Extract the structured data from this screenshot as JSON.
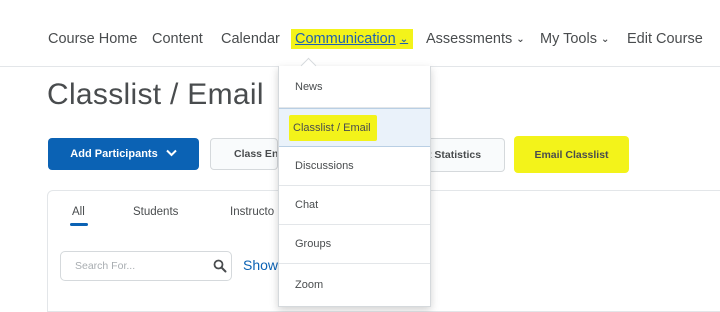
{
  "navbar": {
    "items": [
      {
        "label": "Course Home"
      },
      {
        "label": "Content"
      },
      {
        "label": "Calendar"
      },
      {
        "label": "Communication",
        "chevron": "⌄"
      },
      {
        "label": "Assessments",
        "chevron": "⌄"
      },
      {
        "label": "My Tools",
        "chevron": "⌄"
      },
      {
        "label": "Edit Course"
      }
    ]
  },
  "page": {
    "title": "Classlist / Email"
  },
  "toolbar": {
    "add_participants": "Add Participants",
    "class_engagement": "Class Eng",
    "statistics": "t Statistics",
    "email_classlist": "Email Classlist"
  },
  "tabs": [
    {
      "label": "All"
    },
    {
      "label": "Students"
    },
    {
      "label": "Instructo"
    }
  ],
  "search": {
    "placeholder": "Search For...",
    "show_link": "Show"
  },
  "dropdown": {
    "items": [
      {
        "label": "News"
      },
      {
        "label": "Classlist / Email"
      },
      {
        "label": "Discussions"
      },
      {
        "label": "Chat"
      },
      {
        "label": "Groups"
      },
      {
        "label": "Zoom"
      }
    ]
  },
  "colors": {
    "primary": "#0b62b4",
    "highlight": "#f3f31a",
    "text": "#494c4e",
    "selected_bg": "#eaf2fa"
  },
  "icons": {
    "chevron": "chevron-down-icon",
    "search": "search-icon"
  }
}
